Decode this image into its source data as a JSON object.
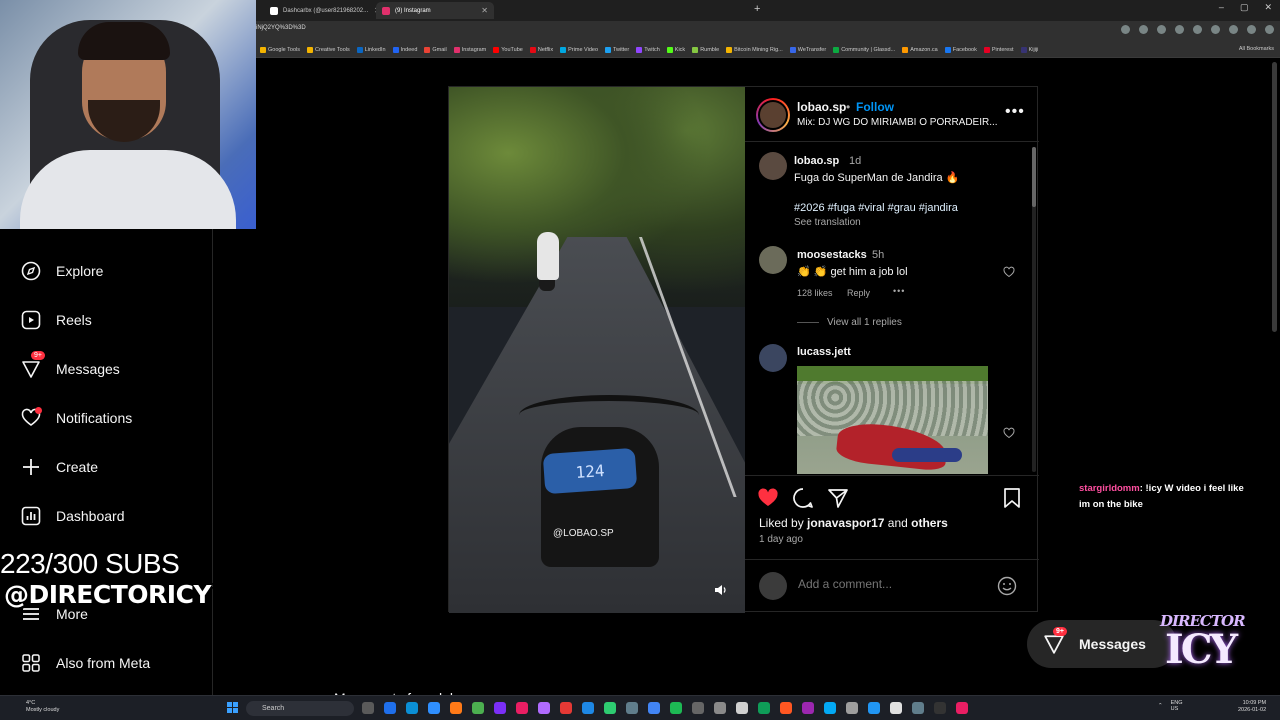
{
  "browser": {
    "tabs": [
      {
        "label": "Dashcarbx (@user821968202...",
        "icon_color": "#000000"
      },
      {
        "label": "(9) Instagram",
        "icon_color": "#e1306c"
      }
    ],
    "url": "iNjQ2YQ%3D%3D",
    "bookmarks": [
      {
        "label": "Google Tools",
        "color": "#f4b400"
      },
      {
        "label": "Creative Tools",
        "color": "#f4b400"
      },
      {
        "label": "LinkedIn",
        "color": "#0a66c2"
      },
      {
        "label": "Indeed",
        "color": "#2164f3"
      },
      {
        "label": "Gmail",
        "color": "#ea4335"
      },
      {
        "label": "Instagram",
        "color": "#e1306c"
      },
      {
        "label": "YouTube",
        "color": "#ff0000"
      },
      {
        "label": "Netflix",
        "color": "#e50914"
      },
      {
        "label": "Prime Video",
        "color": "#00a8e1"
      },
      {
        "label": "Twitter",
        "color": "#1da1f2"
      },
      {
        "label": "Twitch",
        "color": "#9146ff"
      },
      {
        "label": "Kick",
        "color": "#53fc18"
      },
      {
        "label": "Rumble",
        "color": "#85c742"
      },
      {
        "label": "Bitcoin Mining Rig...",
        "color": "#f4b400"
      },
      {
        "label": "WeTransfer",
        "color": "#3767ea"
      },
      {
        "label": "Community | Glassd...",
        "color": "#0caa41"
      },
      {
        "label": "Amazon.ca",
        "color": "#ff9900"
      },
      {
        "label": "Facebook",
        "color": "#1877f2"
      },
      {
        "label": "Pinterest",
        "color": "#e60023"
      },
      {
        "label": "Kijiji",
        "color": "#373373"
      }
    ],
    "all_bookmarks": "All Bookmarks"
  },
  "nav": {
    "items": [
      {
        "label": "Explore",
        "icon": "compass-icon"
      },
      {
        "label": "Reels",
        "icon": "reels-icon"
      },
      {
        "label": "Messages",
        "icon": "messenger-icon",
        "badge": "9+"
      },
      {
        "label": "Notifications",
        "icon": "heart-icon"
      },
      {
        "label": "Create",
        "icon": "plus-icon"
      },
      {
        "label": "Dashboard",
        "icon": "chart-icon"
      },
      {
        "label": "More",
        "icon": "menu-icon"
      },
      {
        "label": "Also from Meta",
        "icon": "grid-icon"
      }
    ]
  },
  "overlay": {
    "subs": "223/300 SUBS",
    "handle": "@DIRECTORICY"
  },
  "post": {
    "username": "lobao.sp",
    "dot": "•",
    "follow": "Follow",
    "audio": "Mix: DJ WG DO MIRIAMBI O PORRADEIR...",
    "more": "•••",
    "video_watermark": "@LOBAO.SP",
    "speedo": "124",
    "caption": {
      "username": "lobao.sp",
      "time": "1d",
      "text": "Fuga do SuperMan de Jandira 🔥",
      "tags": "#2026 #fuga #viral #grau #jandira",
      "see_translation": "See translation"
    },
    "comments": [
      {
        "username": "moosestacks",
        "time": "5h",
        "text": "👏 👏 get him a job lol",
        "likes": "128 likes",
        "reply": "Reply",
        "more": "•••",
        "view_replies": "View all 1 replies"
      },
      {
        "username": "lucass.jett"
      }
    ],
    "liked_by": {
      "prefix": "Liked by",
      "user": "jonavaspor17",
      "and": "and",
      "others": "others"
    },
    "ago": "1 day ago",
    "add_comment_placeholder": "Add a comment..."
  },
  "chat": {
    "user": "stargirldomm",
    "text": ": !icy W video i feel like im on the bike"
  },
  "messages_pill": {
    "label": "Messages",
    "badge": "9+"
  },
  "logo": {
    "top": "DIRECTOR",
    "bottom": "ICY"
  },
  "bottom_text": "More posts from lobao.sp",
  "taskbar": {
    "weather_temp": "4°C",
    "weather_desc": "Mostly cloudy",
    "search": "Search",
    "lang": "ENG",
    "region": "US",
    "time": "10:09 PM",
    "date": "2026-01-02"
  },
  "colors": {
    "accent": "#0095f6",
    "like": "#ff3040",
    "background": "#000000"
  }
}
